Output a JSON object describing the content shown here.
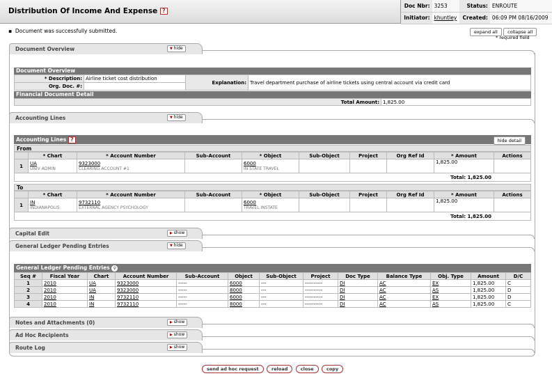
{
  "doc": {
    "title": "Distribution Of Income And Expense",
    "help": "?"
  },
  "header": {
    "doc_nbr_label": "Doc Nbr:",
    "doc_nbr": "3253",
    "status_label": "Status:",
    "status": "ENROUTE",
    "initiator_label": "Initiator:",
    "initiator": "khuntley",
    "created_label": "Created:",
    "created": "06:09 PM 08/16/2009"
  },
  "message": "Document was successfully submitted.",
  "top_buttons": {
    "expand": "expand all",
    "collapse": "collapse all",
    "required": "* required field"
  },
  "tabs": {
    "doc_overview": "Document Overview",
    "accounting": "Accounting Lines",
    "capital": "Capital Edit",
    "glpe": "General Ledger Pending Entries",
    "notes": "Notes and Attachments (0)",
    "adhoc": "Ad Hoc Recipients",
    "route": "Route Log",
    "hide": "hide",
    "show": "show"
  },
  "overview": {
    "section": "Document Overview",
    "desc_label": "* Description:",
    "desc": "Airline ticket cost distribution",
    "org_label": "Org. Doc. #:",
    "org": "",
    "expl_label": "Explanation:",
    "expl": "Travel department purchase of airline tickets using central account via credit card",
    "fin_label": "Financial Document Detail",
    "total_label": "Total Amount:",
    "total": "1,825.00"
  },
  "accounting": {
    "title": "Accounting Lines",
    "hide_detail": "hide detail",
    "from": "From",
    "to": "To",
    "headers": [
      "* Chart",
      "* Account Number",
      "Sub-Account",
      "* Object",
      "Sub-Object",
      "Project",
      "Org Ref Id",
      "* Amount",
      "Actions"
    ],
    "from_row": {
      "num": "1",
      "chart": "UA",
      "chart_sub": "UNIV ADMIN",
      "account": "9323000",
      "account_sub": "CLEARING ACCOUNT #1",
      "object": "6000",
      "object_sub": "IN STATE TRAVEL",
      "amount": "1,825.00"
    },
    "from_total": "Total: 1,825.00",
    "to_row": {
      "num": "1",
      "chart": "IN",
      "chart_sub": "INDIANAPOLIS",
      "account": "9732110",
      "account_sub": "EXTERNAL AGENCY PSYCHOLOGY",
      "object": "6000",
      "object_sub": "TRAVEL INSTATE",
      "amount": "1,825.00"
    },
    "to_total": "Total: 1,825.00"
  },
  "glpe": {
    "title": "General Ledger Pending Entries",
    "headers": [
      "Seq #",
      "Fiscal Year",
      "Chart",
      "Account Number",
      "Sub-Account",
      "Object",
      "Sub-Object",
      "Project",
      "Doc Type",
      "Balance Type",
      "Obj. Type",
      "Amount",
      "D/C"
    ],
    "rows": [
      [
        "1",
        "2010",
        "UA",
        "9323000",
        "-----",
        "6000",
        "---",
        "----------",
        "DI",
        "AC",
        "EX",
        "1,825.00",
        "C"
      ],
      [
        "2",
        "2010",
        "UA",
        "9323000",
        "-----",
        "8000",
        "---",
        "----------",
        "DI",
        "AC",
        "AS",
        "1,825.00",
        "D"
      ],
      [
        "3",
        "2010",
        "IN",
        "9732110",
        "-----",
        "6000",
        "---",
        "----------",
        "DI",
        "AC",
        "EX",
        "1,825.00",
        "D"
      ],
      [
        "4",
        "2010",
        "IN",
        "9732110",
        "-----",
        "8000",
        "---",
        "----------",
        "DI",
        "AC",
        "AS",
        "1,825.00",
        "C"
      ]
    ]
  },
  "bottom_buttons": [
    "send ad hoc request",
    "reload",
    "close",
    "copy"
  ]
}
